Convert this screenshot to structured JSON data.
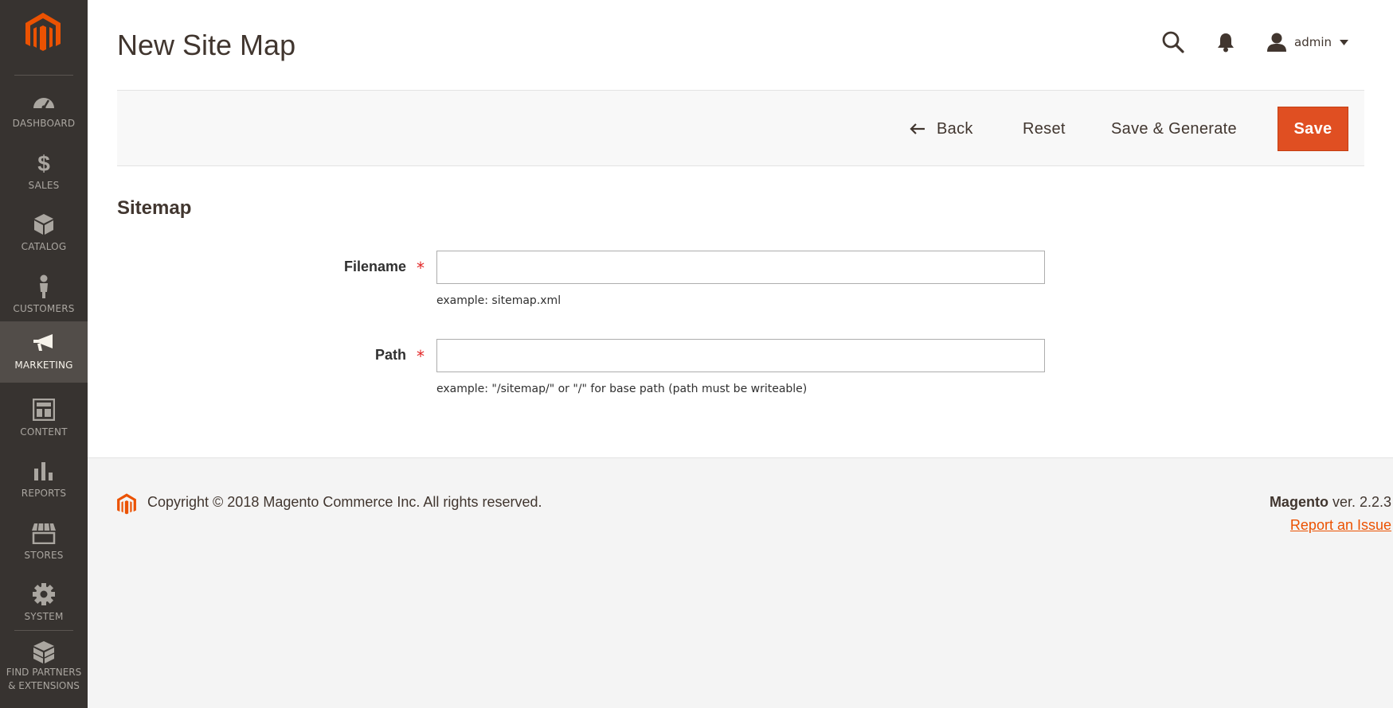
{
  "sidebar": {
    "logo": "magento-logo",
    "items": [
      {
        "label": "DASHBOARD",
        "icon": "dashboard-icon"
      },
      {
        "label": "SALES",
        "icon": "dollar-icon"
      },
      {
        "label": "CATALOG",
        "icon": "box-icon"
      },
      {
        "label": "CUSTOMERS",
        "icon": "person-icon"
      },
      {
        "label": "MARKETING",
        "icon": "megaphone-icon",
        "active": true
      },
      {
        "label": "CONTENT",
        "icon": "layout-icon"
      },
      {
        "label": "REPORTS",
        "icon": "bar-chart-icon"
      },
      {
        "label": "STORES",
        "icon": "storefront-icon"
      },
      {
        "label": "SYSTEM",
        "icon": "gear-icon"
      }
    ],
    "partners": {
      "line1": "FIND PARTNERS",
      "line2": "& EXTENSIONS",
      "icon": "boxes-icon"
    }
  },
  "header": {
    "title": "New Site Map",
    "user_name": "admin"
  },
  "actions": {
    "back": "Back",
    "reset": "Reset",
    "save_generate": "Save & Generate",
    "save": "Save"
  },
  "form": {
    "section_title": "Sitemap",
    "filename": {
      "label": "Filename",
      "required": "*",
      "value": "",
      "note": "example: sitemap.xml"
    },
    "path": {
      "label": "Path",
      "required": "*",
      "value": "",
      "note": "example: \"/sitemap/\" or \"/\" for base path (path must be writeable)"
    }
  },
  "footer": {
    "copyright": "Copyright © 2018 Magento Commerce Inc. All rights reserved.",
    "brand": "Magento",
    "version": " ver. 2.2.3",
    "report_link": "Report an Issue"
  },
  "colors": {
    "sidebar_bg": "#373330",
    "sidebar_active_bg": "#524d49",
    "accent": "#e04f22",
    "required": "#e22626",
    "link": "#eb5202"
  }
}
